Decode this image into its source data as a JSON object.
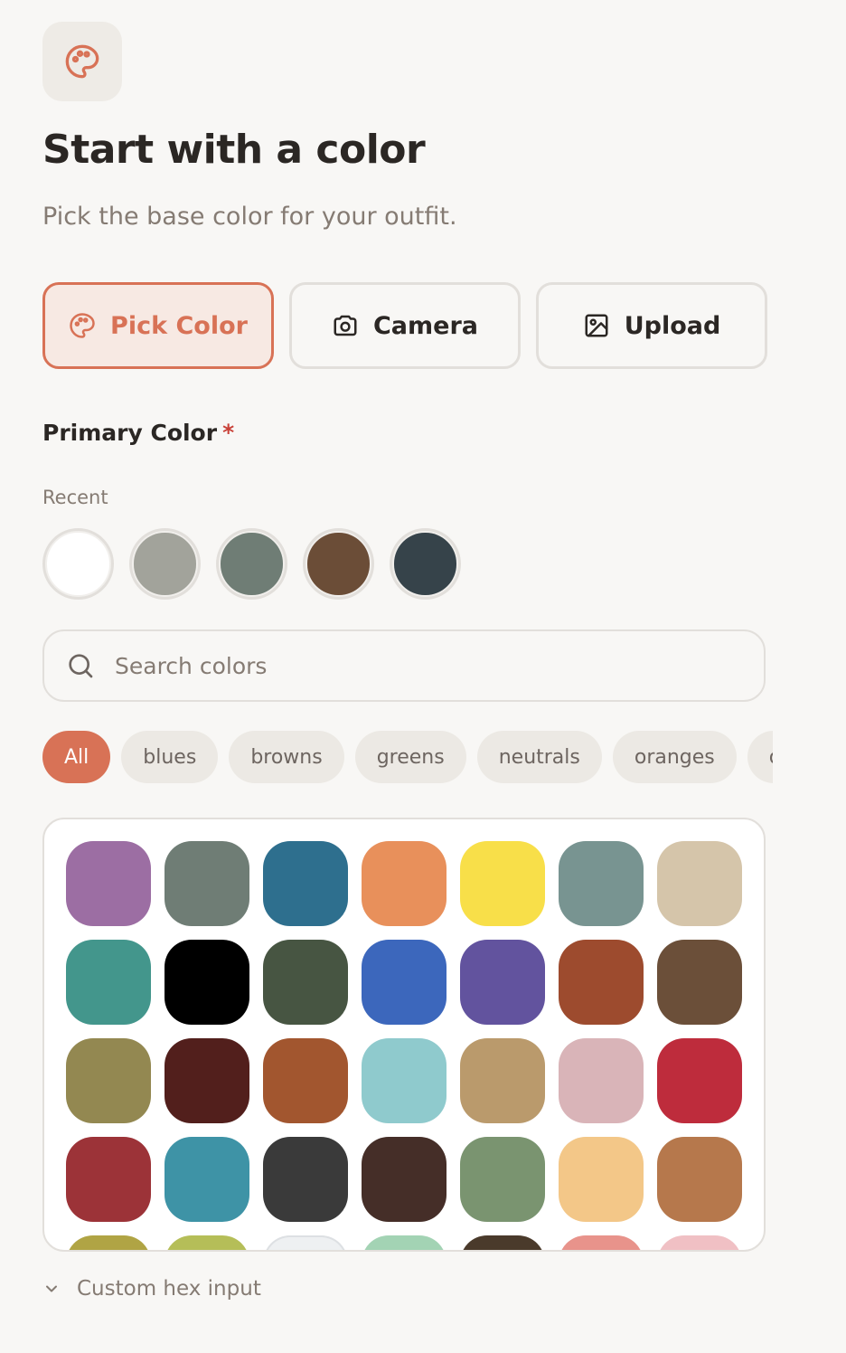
{
  "header": {
    "icon": "palette-icon",
    "title": "Start with a color",
    "subtitle": "Pick the base color for your outfit."
  },
  "modes": [
    {
      "label": "Pick Color",
      "icon": "palette-icon",
      "active": true
    },
    {
      "label": "Camera",
      "icon": "camera-icon",
      "active": false
    },
    {
      "label": "Upload",
      "icon": "image-icon",
      "active": false
    }
  ],
  "primary_color": {
    "label": "Primary Color",
    "required_mark": "*"
  },
  "recent": {
    "label": "Recent",
    "colors": [
      "#ffffff",
      "#a2a39b",
      "#6f7d75",
      "#6b4d37",
      "#36434a"
    ]
  },
  "search": {
    "placeholder": "Search colors",
    "value": ""
  },
  "filters": [
    "All",
    "blues",
    "browns",
    "greens",
    "neutrals",
    "oranges",
    "others"
  ],
  "active_filter": "All",
  "palette": [
    "#9c6ea3",
    "#6f7d75",
    "#2e6f8e",
    "#e8905b",
    "#f8df49",
    "#789491",
    "#d5c5aa",
    "#43968c",
    "#000000",
    "#475542",
    "#3c67bc",
    "#62539e",
    "#9d4b2e",
    "#6b4f39",
    "#938851",
    "#521f1c",
    "#a2562f",
    "#8fcacd",
    "#ba9a6c",
    "#d9b4b8",
    "#be2c3c",
    "#9c3338",
    "#3e93a6",
    "#3a3a3a",
    "#452e28",
    "#7a9470",
    "#f3c788",
    "#b6784c",
    "#b0a444",
    "#b5be58",
    "#eef0f2",
    "#a3d3b4",
    "#4a3a2b",
    "#e8938b",
    "#f0c0c4"
  ],
  "custom_hex": {
    "label": "Custom hex input",
    "icon": "chevron-down-icon"
  },
  "colors": {
    "accent": "#d87256",
    "accent_bg": "#f7e9e3",
    "background": "#f8f7f5",
    "required": "#c94138"
  }
}
